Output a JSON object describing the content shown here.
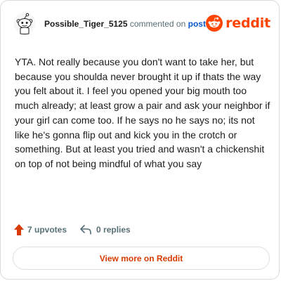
{
  "header": {
    "username": "Possible_Tiger_5125",
    "action_text": "commented on",
    "post_link": "post",
    "brand": "reddit"
  },
  "comment": {
    "text": "YTA. Not really because you don't want to take her, but because you shoulda never brought it up if thats the way you felt about it. I feel you opened your big mouth too much already; at least grow a pair and ask your neighbor if your girl can come too. If he says no he says no; its not like he's gonna flip out and kick you in the crotch or something. But at least you tried and wasn't a chickenshit on top of not being mindful of what you say"
  },
  "stats": {
    "upvotes": "7 upvotes",
    "replies": "0 replies"
  },
  "actions": {
    "view_more": "View more on Reddit"
  },
  "colors": {
    "brand": "#ff4500",
    "link": "#0a58ca",
    "muted": "#576f76",
    "button_text": "#d93a00"
  },
  "icons": {
    "avatar": "snoo-avatar-icon",
    "brand_logo": "reddit-logo-icon",
    "upvote": "upvote-arrow-icon",
    "reply": "reply-arrow-icon"
  }
}
